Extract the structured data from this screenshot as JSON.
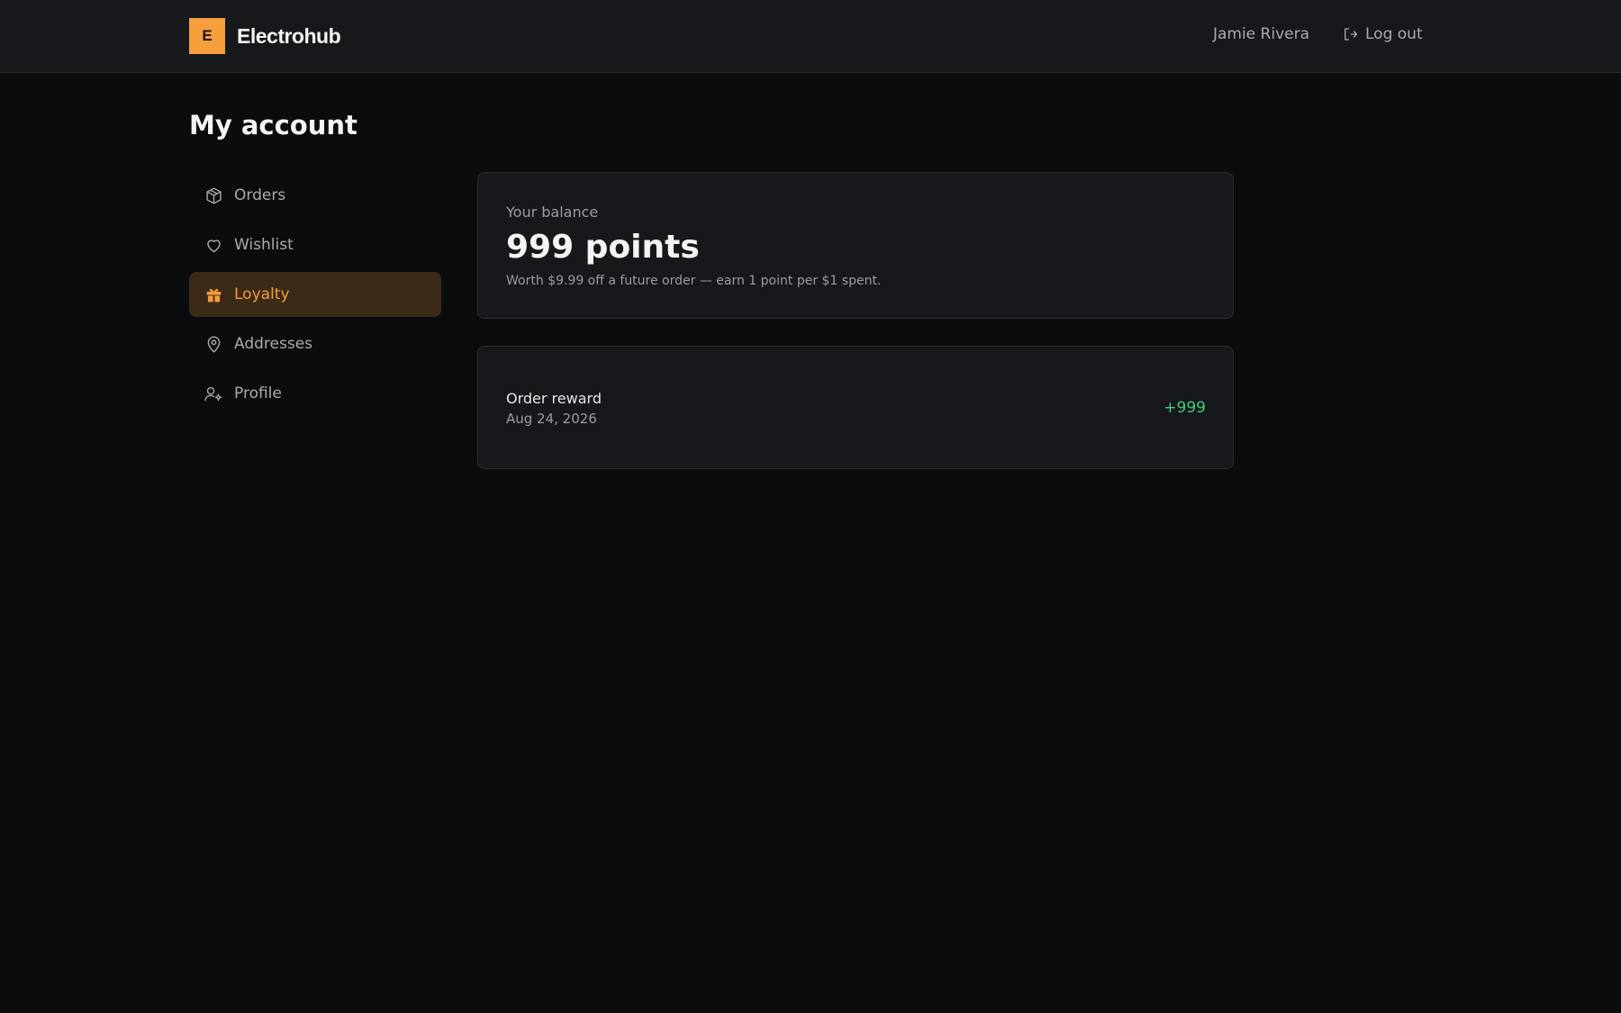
{
  "header": {
    "brand_initial": "E",
    "brand_name": "Electrohub",
    "user_name": "Jamie Rivera",
    "logout_label": "Log out"
  },
  "page": {
    "title": "My account"
  },
  "sidebar": {
    "items": [
      {
        "label": "Orders",
        "icon": "box-icon",
        "active": false
      },
      {
        "label": "Wishlist",
        "icon": "heart-icon",
        "active": false
      },
      {
        "label": "Loyalty",
        "icon": "gift-icon",
        "active": true
      },
      {
        "label": "Addresses",
        "icon": "map-pin-icon",
        "active": false
      },
      {
        "label": "Profile",
        "icon": "user-cog-icon",
        "active": false
      }
    ]
  },
  "balance": {
    "label": "Your balance",
    "value": "999 points",
    "note": "Worth $9.99 off a future order — earn 1 point per $1 spent."
  },
  "history": [
    {
      "title": "Order reward",
      "date": "Aug 24, 2026",
      "points": "+999"
    }
  ],
  "colors": {
    "accent": "#f59e3b",
    "active_bg": "#3b2a17",
    "positive": "#3ecf7a",
    "background": "#0b0c0e",
    "surface": "#17181b"
  }
}
